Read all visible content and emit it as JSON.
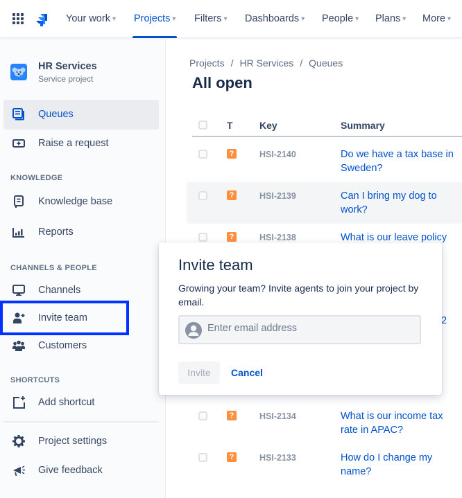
{
  "topnav": {
    "items": [
      {
        "label": "Your work",
        "active": false
      },
      {
        "label": "Projects",
        "active": true
      },
      {
        "label": "Filters",
        "active": false
      },
      {
        "label": "Dashboards",
        "active": false
      },
      {
        "label": "People",
        "active": false
      },
      {
        "label": "Plans",
        "active": false
      },
      {
        "label": "More",
        "active": false
      }
    ],
    "chevron": "⌄"
  },
  "sidebar": {
    "project": {
      "name": "HR Services",
      "type": "Service project"
    },
    "items": [
      {
        "label": "Queues",
        "icon": "queues-icon",
        "selected": true
      },
      {
        "label": "Raise a request",
        "icon": "raise-request-icon"
      },
      {
        "label": "Knowledge base",
        "icon": "knowledge-base-icon"
      },
      {
        "label": "Reports",
        "icon": "reports-icon"
      },
      {
        "label": "Channels",
        "icon": "channels-icon"
      },
      {
        "label": "Invite team",
        "icon": "invite-team-icon"
      },
      {
        "label": "Customers",
        "icon": "customers-icon"
      },
      {
        "label": "Add shortcut",
        "icon": "add-shortcut-icon"
      },
      {
        "label": "Project settings",
        "icon": "gear-icon"
      },
      {
        "label": "Give feedback",
        "icon": "megaphone-icon"
      }
    ],
    "sections": {
      "knowledge": "KNOWLEDGE",
      "channels": "CHANNELS & PEOPLE",
      "shortcuts": "SHORTCUTS"
    }
  },
  "main": {
    "breadcrumb": [
      "Projects",
      "HR Services",
      "Queues"
    ],
    "breadcrumb_sep": "/",
    "title": "All open",
    "columns": {
      "type": "T",
      "key": "Key",
      "summary": "Summary"
    },
    "rows": [
      {
        "key": "HSI-2140",
        "summary": "Do we have a tax base in Sweden?",
        "type": "?"
      },
      {
        "key": "HSI-2139",
        "summary": "Can I bring my dog to work?",
        "type": "?"
      },
      {
        "key": "HSI-2138",
        "summary": "What is our leave policy",
        "type": "?"
      },
      {
        "key": "HSI-2134",
        "summary": "What is our income tax rate in APAC?",
        "type": "?"
      },
      {
        "key": "HSI-2133",
        "summary": "How do I change my name?",
        "type": "?"
      }
    ],
    "partial_text": "2"
  },
  "dialog": {
    "title": "Invite team",
    "description": "Growing your team? Invite agents to join your project by email.",
    "email_placeholder": "Enter email address",
    "email_value": "",
    "invite_label": "Invite",
    "cancel_label": "Cancel"
  }
}
